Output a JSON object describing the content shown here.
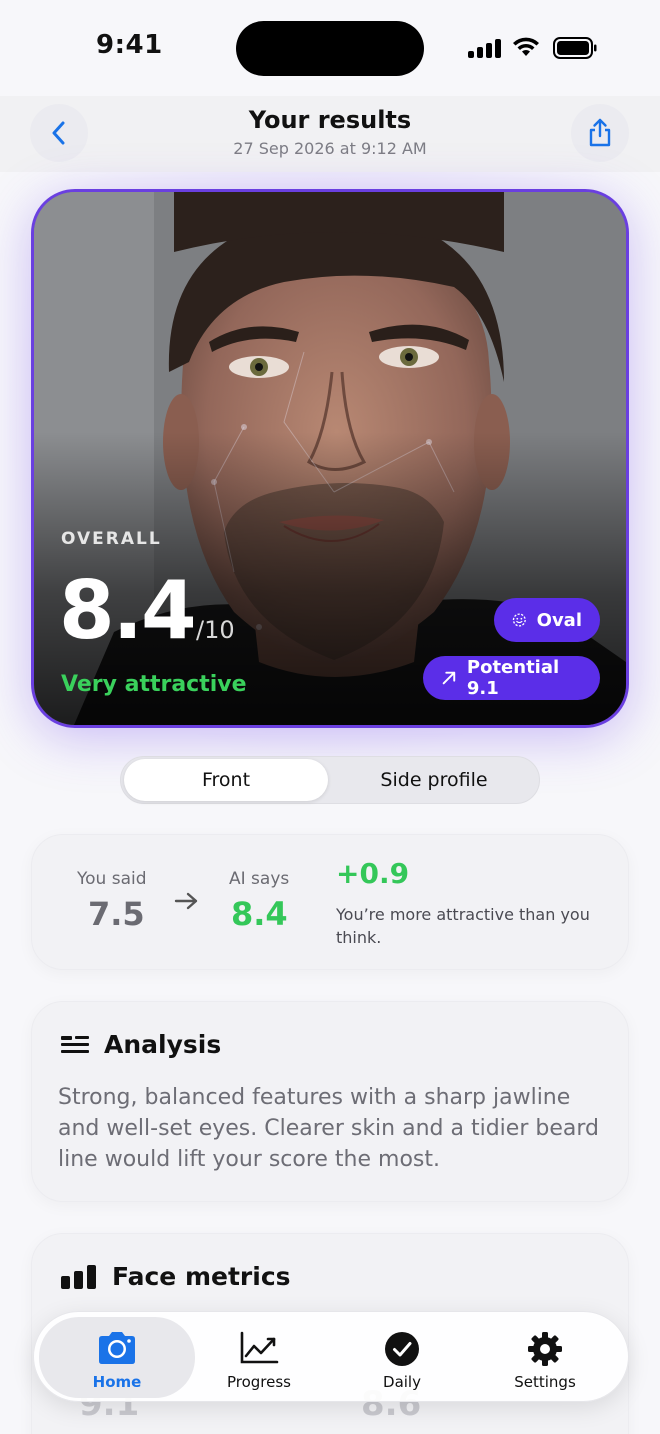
{
  "status": {
    "time": "9:41"
  },
  "nav": {
    "title": "Your results",
    "subtitle": "27 Sep 2026 at 9:12 AM"
  },
  "hero": {
    "overall_label": "OVERALL",
    "score": "8.4",
    "score_max": "/10",
    "verdict": "Very attractive",
    "face_shape": "Oval",
    "potential": "Potential 9.1",
    "verdict_color": "#3ad15c",
    "accent": "#5b2ee8"
  },
  "segment": {
    "front": "Front",
    "side": "Side profile",
    "selected": "Front"
  },
  "comparison": {
    "you_label": "You said",
    "you_value": "7.5",
    "ai_label": "AI says",
    "ai_value": "8.4",
    "delta": "+0.9",
    "message": "You’re more attractive than you think."
  },
  "analysis": {
    "title": "Analysis",
    "text": "Strong, balanced features with a sharp jawline and well-set eyes. Clearer skin and a tidier beard line would lift your score the most."
  },
  "metrics": {
    "title": "Face metrics",
    "value_1": "9.1",
    "value_2": "8.6"
  },
  "tabbar": {
    "items": [
      {
        "label": "Home",
        "icon": "camera-icon",
        "active": true
      },
      {
        "label": "Progress",
        "icon": "chart-line-icon",
        "active": false
      },
      {
        "label": "Daily",
        "icon": "check-circle-icon",
        "active": false
      },
      {
        "label": "Settings",
        "icon": "gear-icon",
        "active": false
      }
    ]
  },
  "colors": {
    "green": "#34c759",
    "blue": "#1a73e8",
    "purple": "#5b2ee8"
  }
}
